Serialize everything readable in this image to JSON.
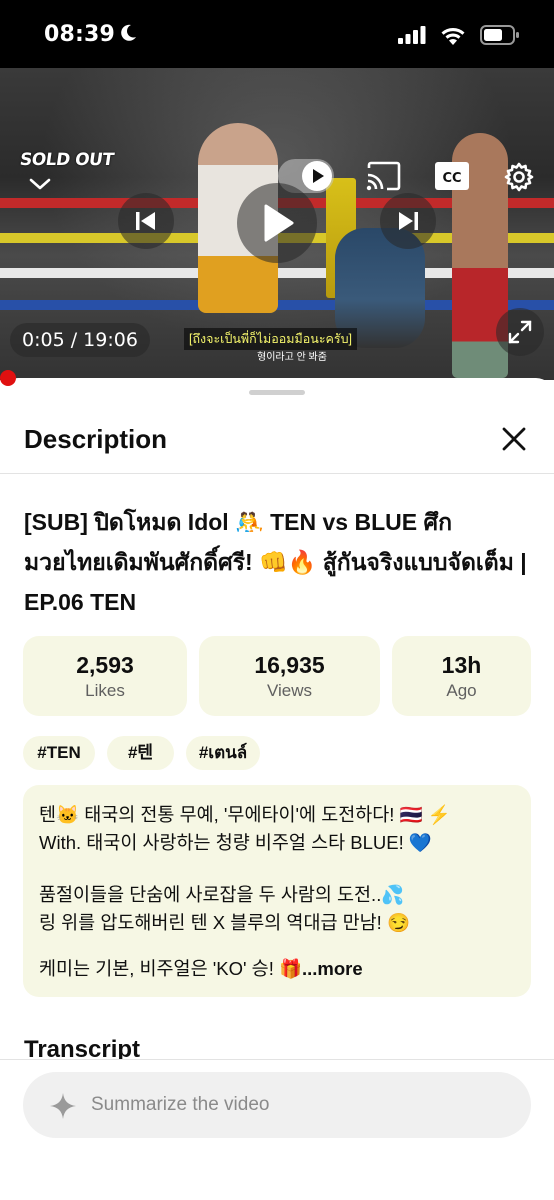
{
  "status_bar": {
    "time": "08:39"
  },
  "player": {
    "logo_text": "SOLD OUT",
    "current_time": "0:05",
    "duration_sep": " / ",
    "duration": "19:06",
    "subtitle_thai": "[ถึงจะเป็นพี่ก็ไม่ออมมือนะครับ]",
    "subtitle_korean": "형이라고 안 봐줌",
    "progress": 0.004
  },
  "sheet": {
    "title": "Description",
    "video_title": "[SUB] ปิดโหมด Idol 🤼 TEN vs BLUE ศึกมวยไทยเดิมพันศักดิ์ศรี! 👊🔥 สู้กันจริงแบบจัดเต็ม | EP.06 TEN",
    "stats": [
      {
        "value": "2,593",
        "label": "Likes"
      },
      {
        "value": "16,935",
        "label": "Views"
      },
      {
        "value": "13h",
        "label": "Ago"
      }
    ],
    "tags": [
      "#TEN",
      "#텐",
      "#เตนล์"
    ],
    "description_lines": [
      "텐🐱 태국의 전통 무예, '무에타이'에 도전하다! 🇹🇭 ⚡",
      "With. 태국이 사랑하는 청량 비주얼 스타 BLUE! 💙",
      "",
      "품절이들을 단숨에 사로잡을 두 사람의 도전..💦",
      "링 위를 압도해버린 텐 X 블루의 역대급 만남! 😏",
      "",
      "케미는 기본, 비주얼은 'KO' 승! 🎁"
    ],
    "more_label": "...more",
    "transcript_heading": "Transcript"
  },
  "summarize": {
    "placeholder": "Summarize the video"
  }
}
